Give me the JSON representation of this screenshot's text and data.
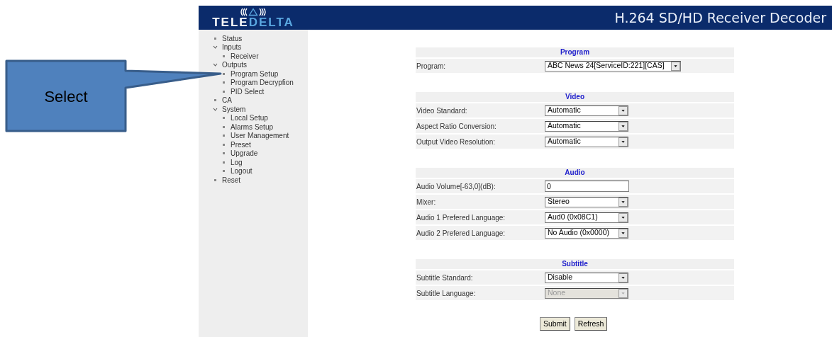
{
  "header": {
    "logo": {
      "word_1": "TELE",
      "word_2": "DELTA"
    },
    "title": "H.264 SD/HD Receiver Decoder"
  },
  "sidebar": {
    "items": [
      {
        "label": "Status"
      },
      {
        "label": "Inputs",
        "expanded": true,
        "children": [
          {
            "label": "Receiver"
          }
        ]
      },
      {
        "label": "Outputs",
        "expanded": true,
        "children": [
          {
            "label": "Program Setup"
          },
          {
            "label": "Program Decrypfion"
          },
          {
            "label": "PID Select"
          }
        ]
      },
      {
        "label": "CA"
      },
      {
        "label": "System",
        "expanded": true,
        "children": [
          {
            "label": "Local Setup"
          },
          {
            "label": "Alarms Setup"
          },
          {
            "label": "User Management"
          },
          {
            "label": "Preset"
          },
          {
            "label": "Upgrade"
          },
          {
            "label": "Log"
          },
          {
            "label": "Logout"
          }
        ]
      },
      {
        "label": "Reset"
      }
    ]
  },
  "callout": {
    "text": "Select"
  },
  "sections": [
    {
      "title": "Program",
      "rows": [
        {
          "label": "Program:",
          "kind": "select",
          "value": "ABC News 24[ServiceID:221][CAS]",
          "wide": true,
          "disabled": false
        }
      ]
    },
    {
      "title": "Video",
      "rows": [
        {
          "label": "Video Standard:",
          "kind": "select",
          "value": "Automatic",
          "disabled": false
        },
        {
          "label": "Aspect Ratio Conversion:",
          "kind": "select",
          "value": "Automatic",
          "disabled": false
        },
        {
          "label": "Output Video Resolution:",
          "kind": "select",
          "value": "Automatic",
          "disabled": false
        }
      ]
    },
    {
      "title": "Audio",
      "rows": [
        {
          "label": "Audio Volume[-63,0](dB):",
          "kind": "text",
          "value": "0",
          "disabled": false
        },
        {
          "label": "Mixer:",
          "kind": "select",
          "value": "Stereo",
          "disabled": false
        },
        {
          "label": "Audio 1 Prefered Language:",
          "kind": "select",
          "value": "Aud0 (0x08C1)",
          "disabled": false
        },
        {
          "label": "Audio 2 Prefered Language:",
          "kind": "select",
          "value": "No Audio (0x0000)",
          "disabled": false
        }
      ]
    },
    {
      "title": "Subtitle",
      "rows": [
        {
          "label": "Subtitle Standard:",
          "kind": "select",
          "value": "Disable",
          "disabled": false
        },
        {
          "label": "Subtitle Language:",
          "kind": "select",
          "value": "None",
          "disabled": true
        }
      ]
    }
  ],
  "buttons": [
    "Submit",
    "Refresh"
  ]
}
